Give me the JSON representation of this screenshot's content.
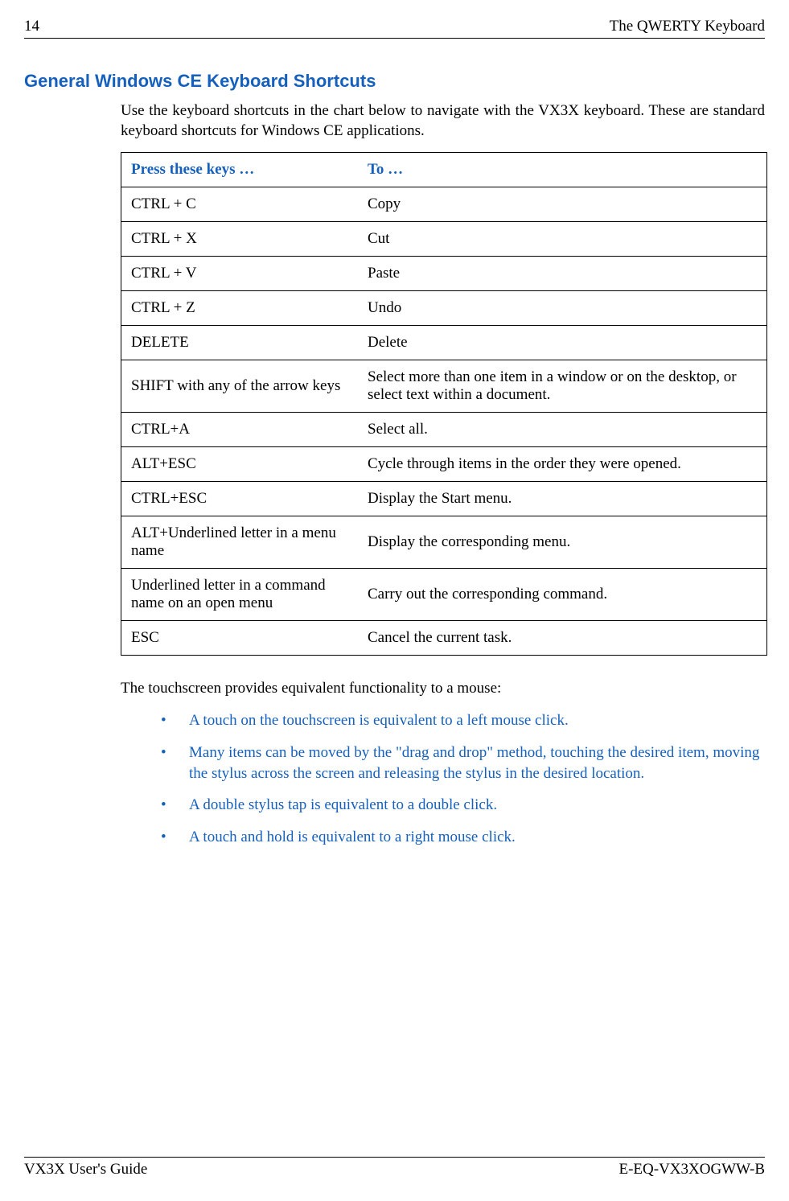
{
  "header": {
    "pageNum": "14",
    "chapter": "The QWERTY Keyboard"
  },
  "section": {
    "title": "General Windows CE Keyboard Shortcuts",
    "intro": "Use the keyboard shortcuts in the chart below to navigate with the VX3X keyboard. These are standard keyboard shortcuts for Windows CE applications."
  },
  "table": {
    "headers": {
      "col1": "Press these keys …",
      "col2": "To …"
    },
    "rows": [
      {
        "keys": "CTRL + C",
        "action": "Copy"
      },
      {
        "keys": "CTRL + X",
        "action": "Cut"
      },
      {
        "keys": "CTRL + V",
        "action": "Paste"
      },
      {
        "keys": "CTRL + Z",
        "action": "Undo"
      },
      {
        "keys": "DELETE",
        "action": "Delete"
      },
      {
        "keys": "SHIFT with any of the arrow keys",
        "action": "Select more than one item in a window or on the desktop, or select text within a document."
      },
      {
        "keys": "CTRL+A",
        "action": "Select all."
      },
      {
        "keys": "ALT+ESC",
        "action": "Cycle through items in the order they were opened."
      },
      {
        "keys": "CTRL+ESC",
        "action": "Display the Start menu."
      },
      {
        "keys": "ALT+Underlined letter in a menu name",
        "action": "Display the corresponding menu."
      },
      {
        "keys": "Underlined letter in a command name on an open menu",
        "action": "Carry out the corresponding command."
      },
      {
        "keys": "ESC",
        "action": "Cancel the current task."
      }
    ]
  },
  "touchscreen": {
    "intro": "The touchscreen provides equivalent functionality to a mouse:",
    "items": [
      "A touch on the touchscreen is equivalent to a left mouse click.",
      "Many items can be moved by the \"drag and drop\" method, touching the desired item, moving the stylus across the screen and releasing the stylus in the desired location.",
      "A double stylus tap is equivalent to a double click.",
      "A touch and hold is equivalent to a right mouse click."
    ]
  },
  "footer": {
    "left": "VX3X User's Guide",
    "right": "E-EQ-VX3XOGWW-B"
  }
}
